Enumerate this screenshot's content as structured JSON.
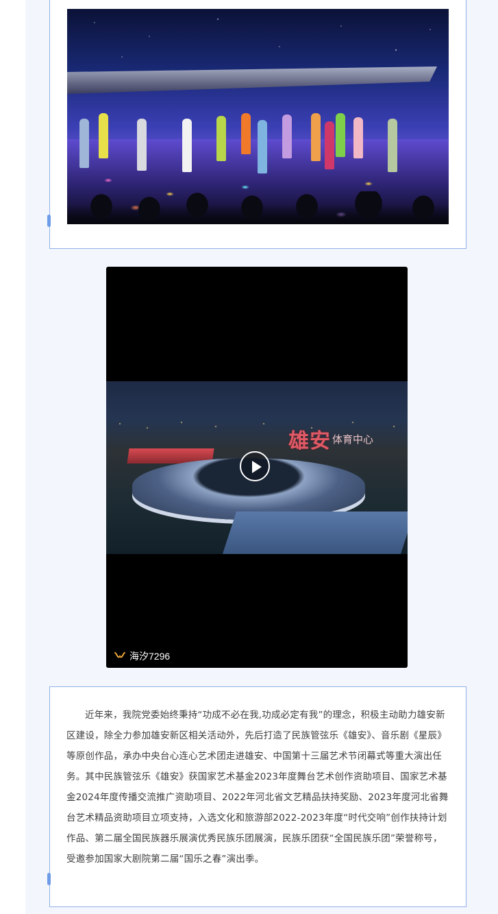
{
  "video": {
    "title_mark": "雄安",
    "title_sub": "体育中心",
    "watermark": "海汐7296"
  },
  "article": {
    "paragraph": "近年来，我院党委始终秉持“功成不必在我,功成必定有我”的理念，积极主动助力雄安新区建设，除全力参加雄安新区相关活动外，先后打造了民族管弦乐《雄安》、音乐剧《星辰》等原创作品，承办中央台心连心艺术团走进雄安、中国第十三届艺术节闭幕式等重大演出任务。其中民族管弦乐《雄安》获国家艺术基金2023年度舞台艺术创作资助项目、国家艺术基金2024年度传播交流推广资助项目、2022年河北省文艺精品扶持奖励、2023年度河北省舞台艺术精品资助项目立项支持，入选文化和旅游部2022-2023年度“时代交响”创作扶持计划作品、第二届全国民族器乐展演优秀民族乐团展演，民族乐团获“全国民族乐团”荣誉称号，受邀参加国家大剧院第二届“国乐之春”演出季。"
  },
  "colors": {
    "card_border": "#8fb0e6",
    "side_tab": "#6e9be8",
    "page_bg": "#f3f7fd",
    "body_text": "#3d3d3d"
  },
  "icons": {
    "play": "play-icon",
    "watermark": "channels-logo-icon"
  }
}
